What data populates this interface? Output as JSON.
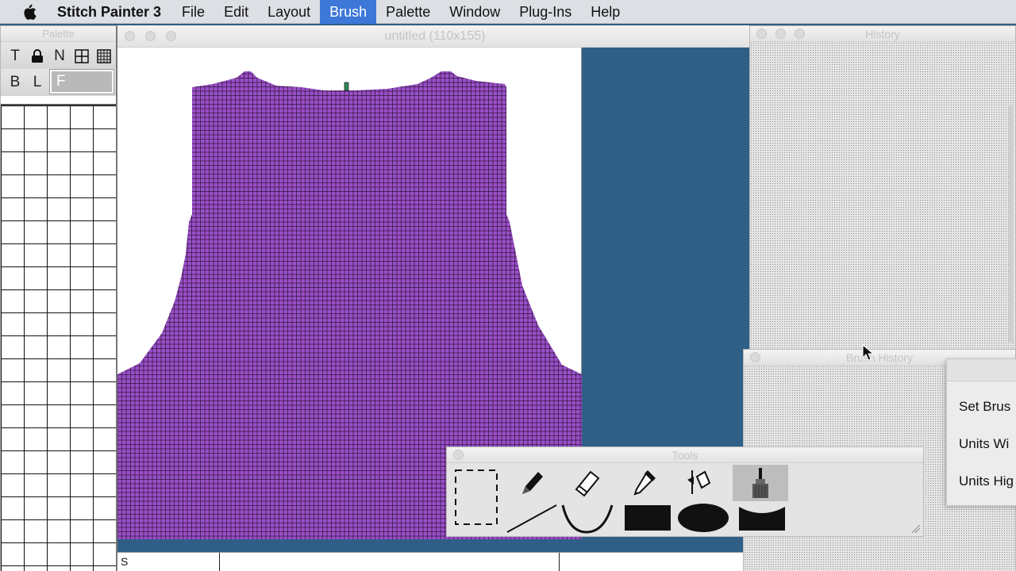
{
  "menubar": {
    "app_name": "Stitch Painter 3",
    "items": [
      {
        "label": "File"
      },
      {
        "label": "Edit"
      },
      {
        "label": "Layout"
      },
      {
        "label": "Brush",
        "active": true
      },
      {
        "label": "Palette"
      },
      {
        "label": "Window"
      },
      {
        "label": "Plug-Ins"
      },
      {
        "label": "Help"
      }
    ]
  },
  "palette": {
    "title": "Palette",
    "row1": [
      "T",
      "lock",
      "N",
      "grid-plus",
      "grid-full"
    ],
    "row2_buttons": [
      "B",
      "L"
    ],
    "field_value": "F"
  },
  "document": {
    "title": "untitled (110x155)",
    "status_text": "S",
    "stitch_color": "#9a4fc9",
    "marker_color": "#2e8b57"
  },
  "history": {
    "title": "History"
  },
  "brush_history": {
    "title": "Brush History"
  },
  "brush_panel": {
    "label_set_brush": "Set Brus",
    "label_units_width": "Units Wi",
    "label_units_height": "Units Hig"
  },
  "tools": {
    "title": "Tools",
    "row1": [
      "marquee-icon",
      "pencil-icon",
      "eraser-icon",
      "eyedropper-icon",
      "paint-bucket-icon",
      "brush-icon"
    ],
    "row2": [
      "line-icon",
      "curve-icon",
      "rectangle-icon",
      "oval-icon",
      "shape-icon"
    ],
    "selected": "brush-icon"
  },
  "colors": {
    "accent": "#3d78d8",
    "desktop": "#2f5f86"
  }
}
